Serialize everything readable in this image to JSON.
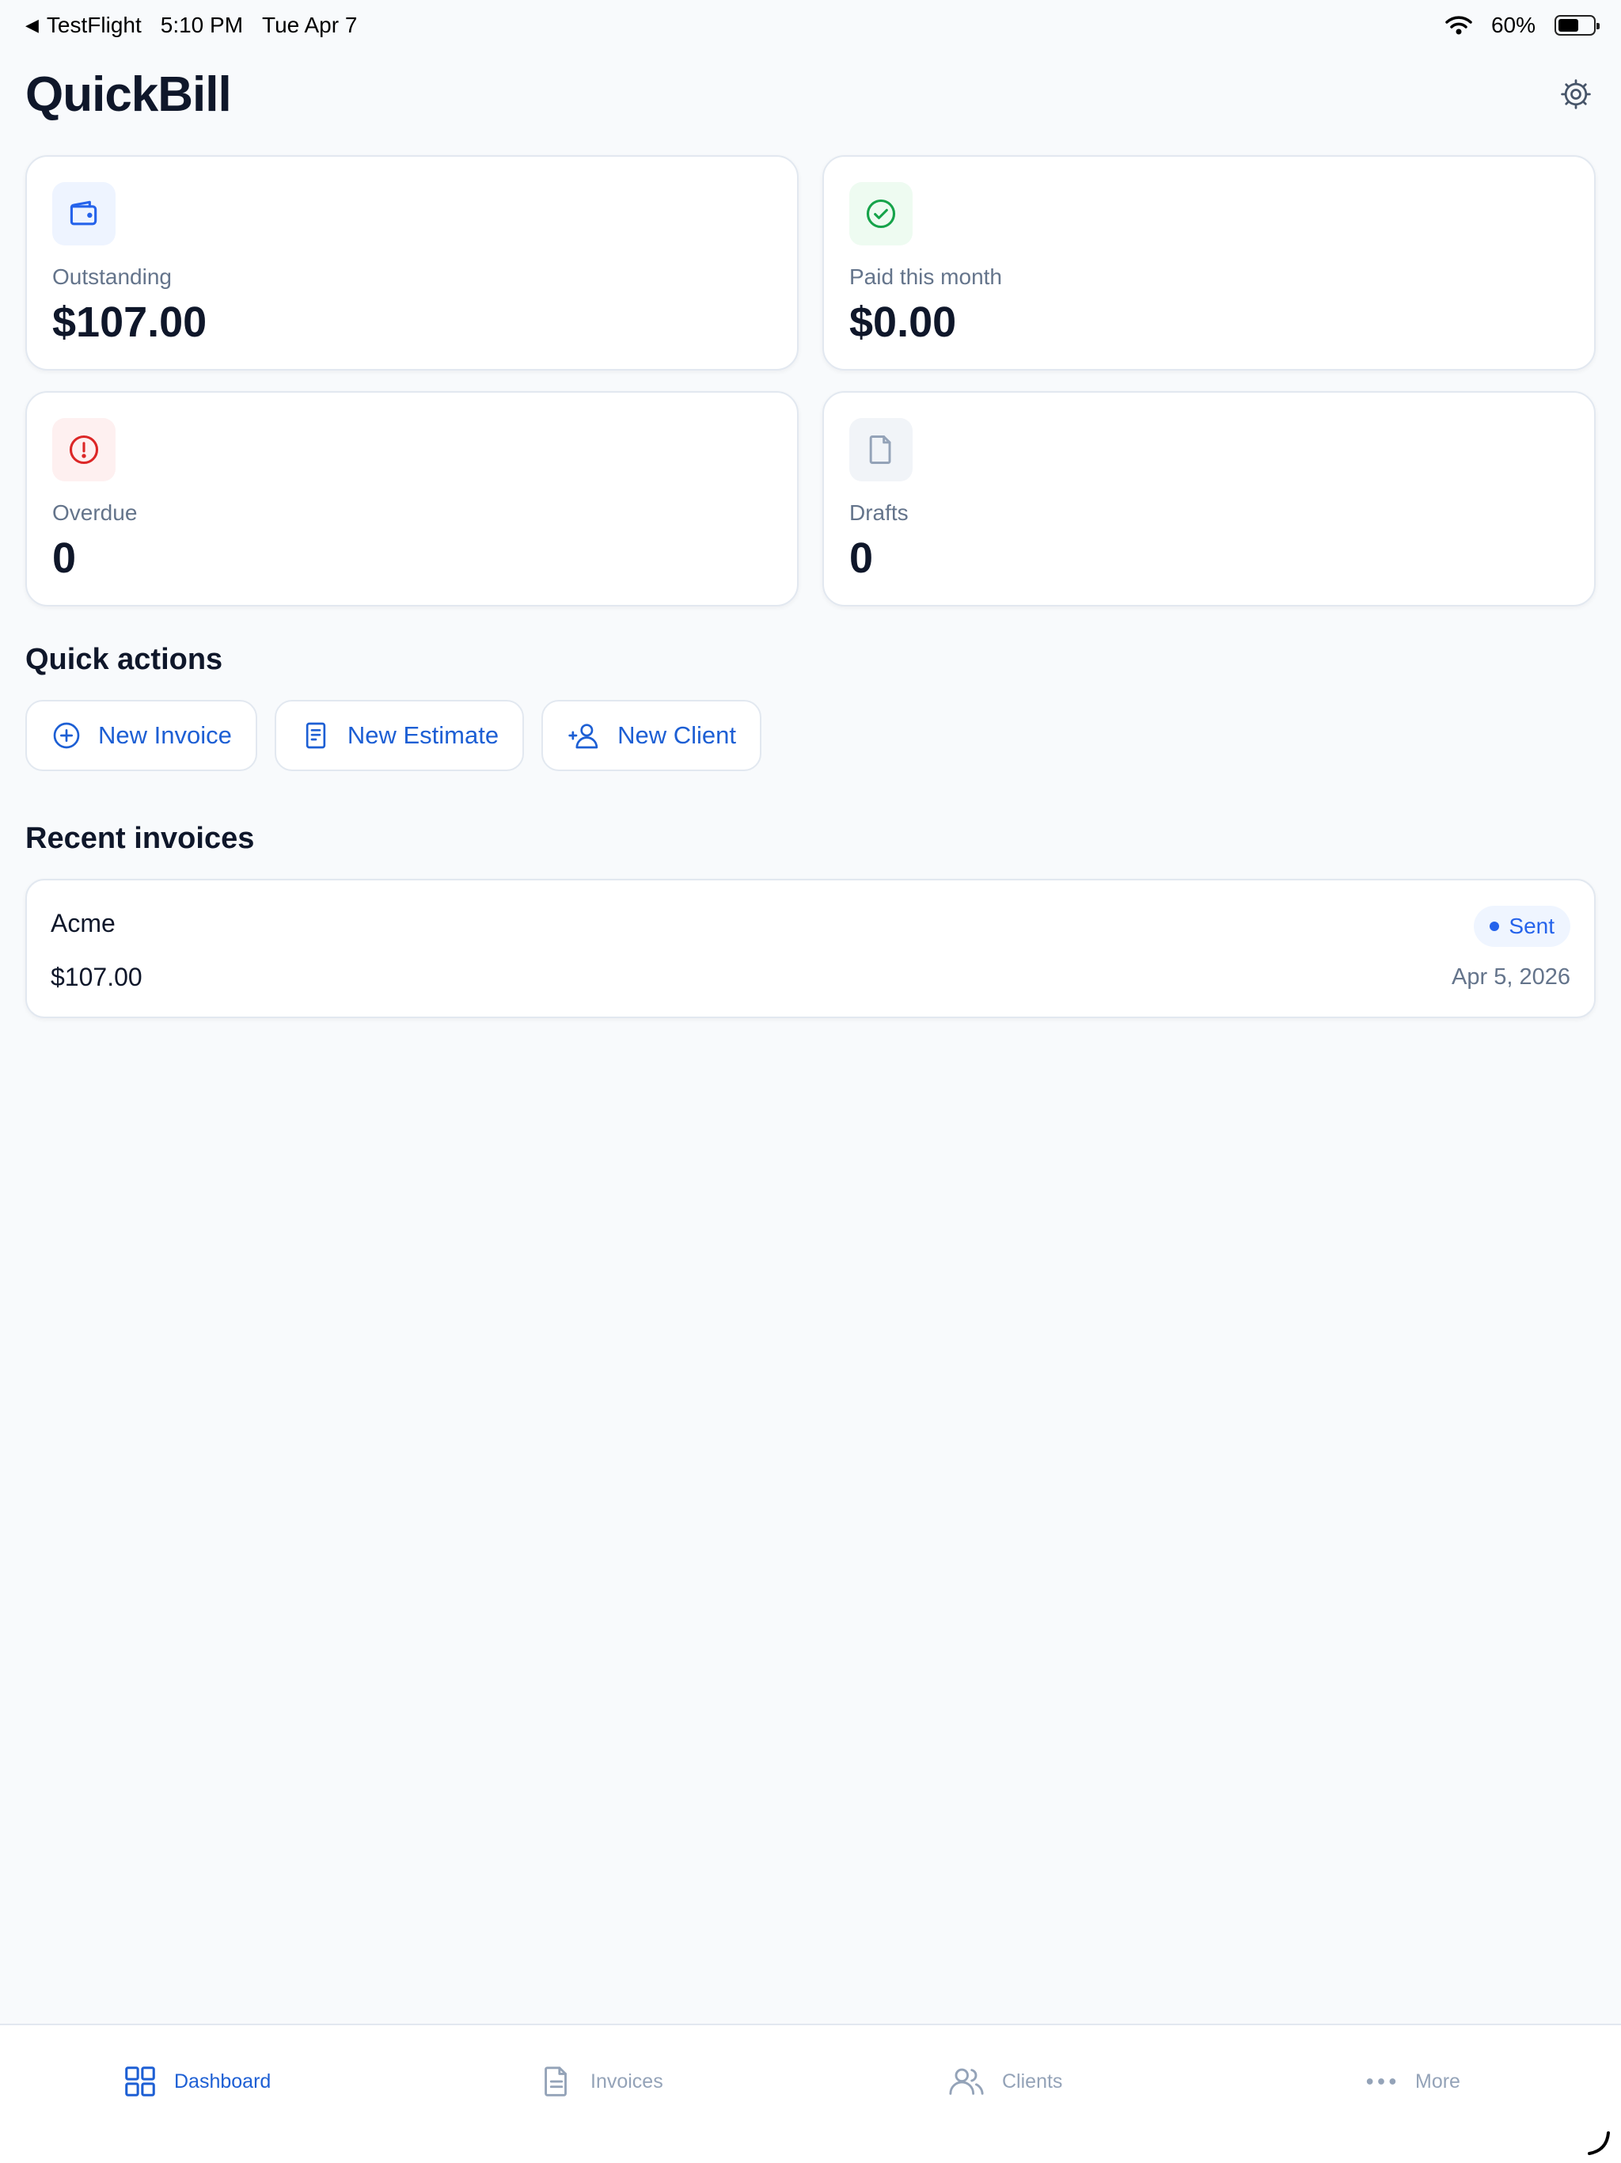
{
  "status_bar": {
    "back_app": "TestFlight",
    "time": "5:10 PM",
    "date": "Tue Apr 7",
    "battery": "60%",
    "battery_level": 0.6
  },
  "header": {
    "title": "QuickBill",
    "settings_icon": "gear-icon"
  },
  "stats": [
    {
      "label": "Outstanding",
      "value": "$107.00",
      "icon": "wallet-icon",
      "color": "#2563eb",
      "bg": "#eef4ff"
    },
    {
      "label": "Paid this month",
      "value": "$0.00",
      "icon": "check-circle-icon",
      "color": "#16a34a",
      "bg": "#eefbf1"
    },
    {
      "label": "Overdue",
      "value": "0",
      "icon": "alert-circle-icon",
      "color": "#dc2626",
      "bg": "#fef0f0"
    },
    {
      "label": "Drafts",
      "value": "0",
      "icon": "file-icon",
      "color": "#94a3b8",
      "bg": "#f1f4f8"
    }
  ],
  "quick_actions": {
    "title": "Quick actions",
    "items": [
      {
        "label": "New Invoice",
        "icon": "plus-circle-icon"
      },
      {
        "label": "New Estimate",
        "icon": "document-icon"
      },
      {
        "label": "New Client",
        "icon": "user-plus-icon"
      }
    ]
  },
  "recent_invoices": {
    "title": "Recent invoices",
    "items": [
      {
        "client": "Acme",
        "amount": "$107.00",
        "status": "Sent",
        "date": "Apr 5, 2026"
      }
    ]
  },
  "tab_bar": {
    "active": "Dashboard",
    "items": [
      {
        "label": "Dashboard",
        "icon": "grid-icon"
      },
      {
        "label": "Invoices",
        "icon": "file-text-icon"
      },
      {
        "label": "Clients",
        "icon": "users-icon"
      },
      {
        "label": "More",
        "icon": "more-dots-icon"
      }
    ]
  },
  "colors": {
    "accent": "#1d5fd4",
    "background": "#f8fafc",
    "text": "#0f172a",
    "muted": "#64748b"
  }
}
